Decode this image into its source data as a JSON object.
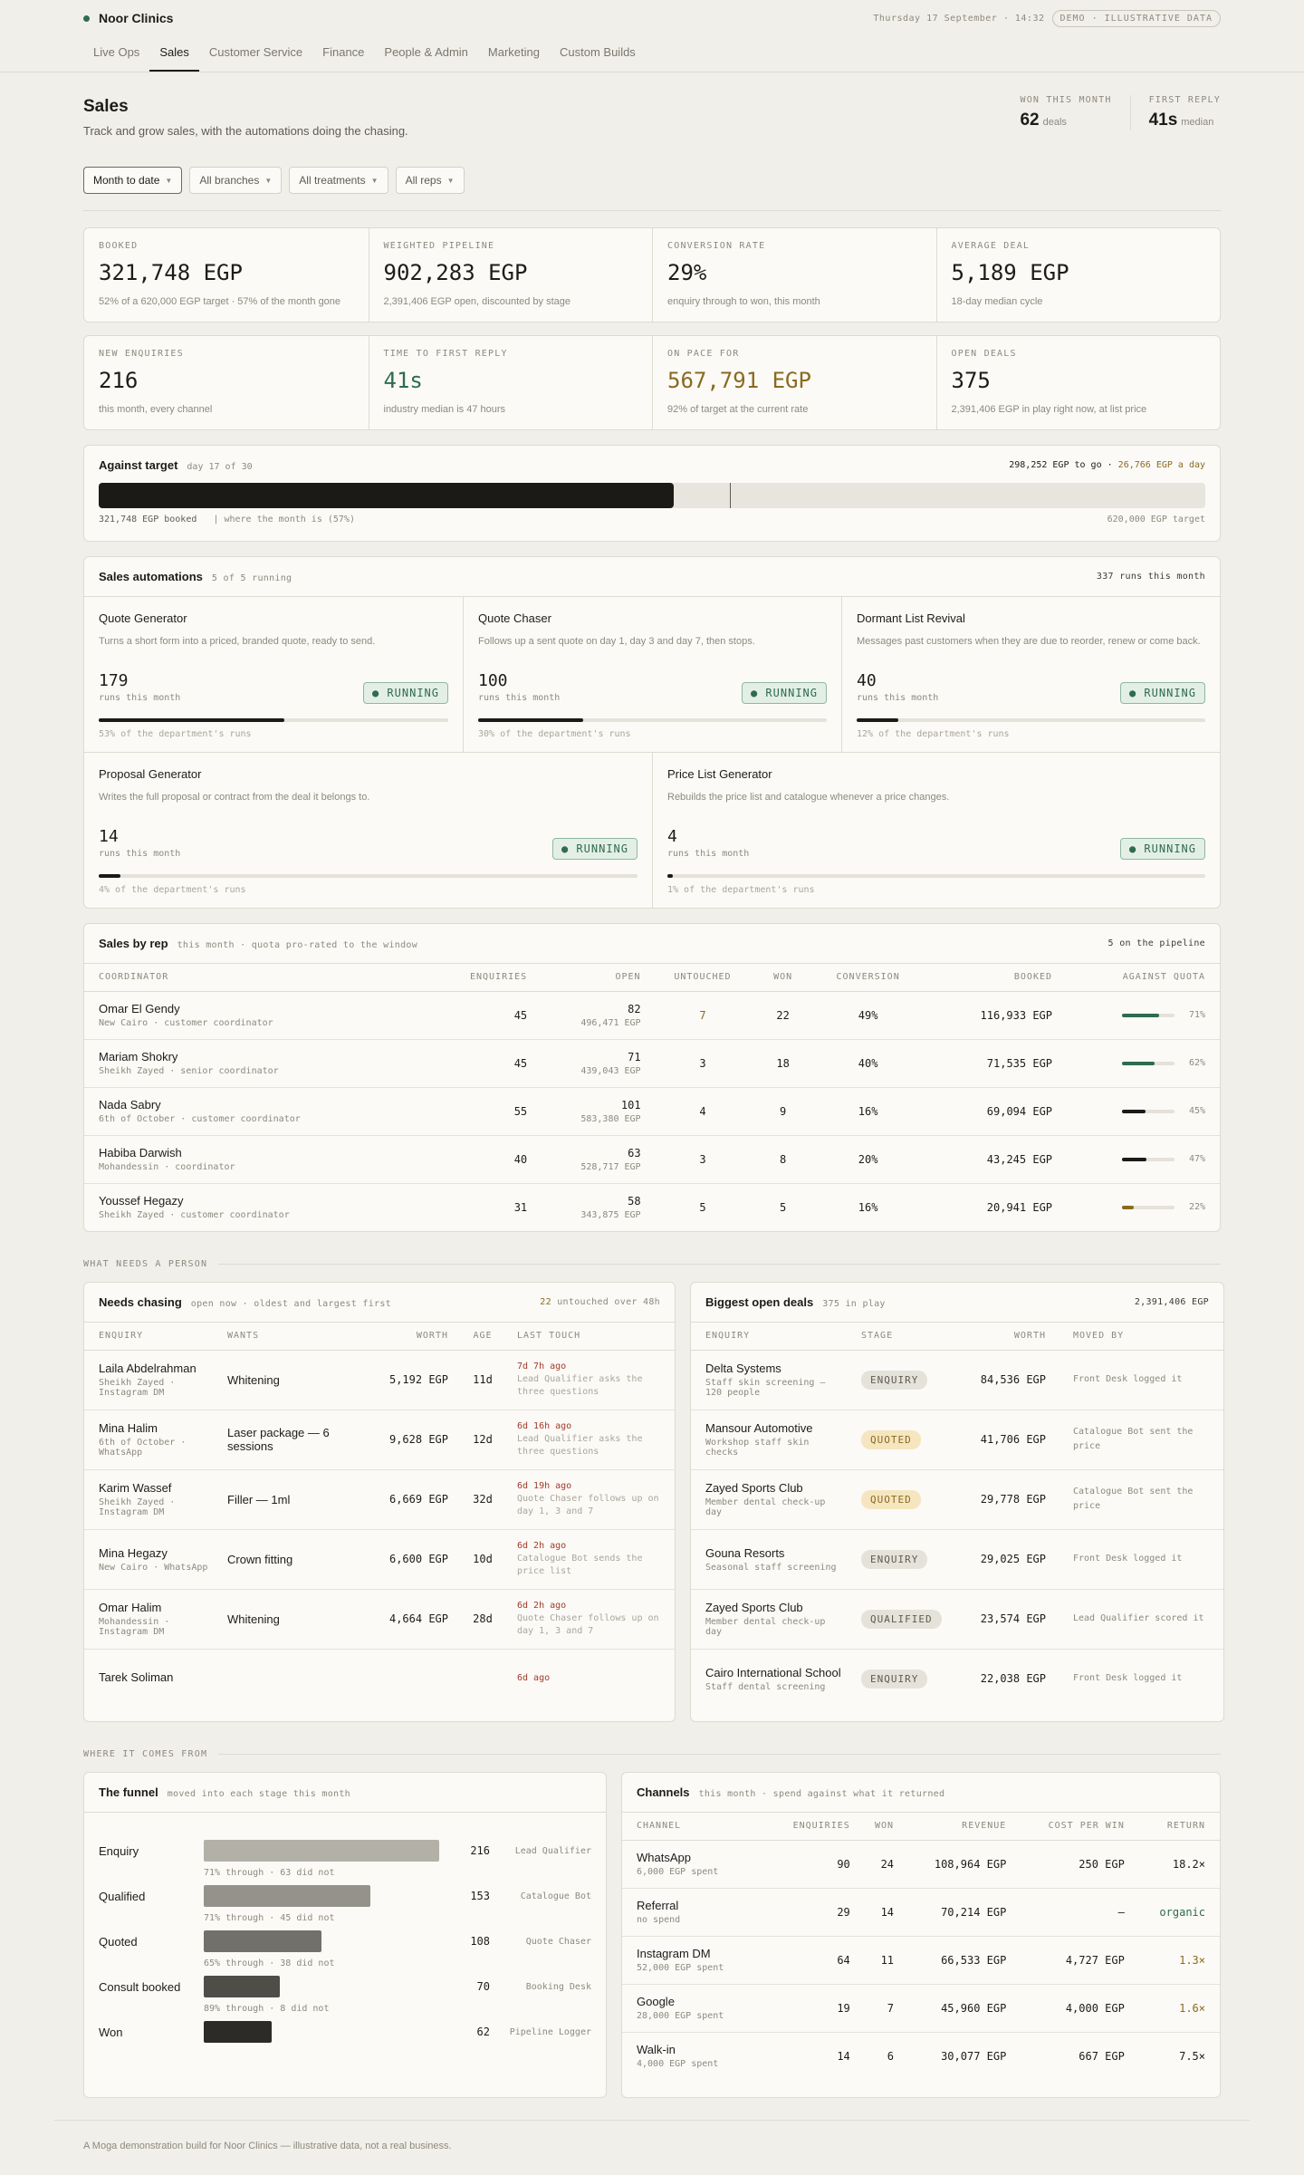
{
  "brand": "Noor Clinics",
  "datetime": "Thursday 17 September · 14:32",
  "demo_badge": "DEMO · ILLUSTRATIVE DATA",
  "tabs": [
    "Live Ops",
    "Sales",
    "Customer Service",
    "Finance",
    "People & Admin",
    "Marketing",
    "Custom Builds"
  ],
  "active_tab": "Sales",
  "page": {
    "title": "Sales",
    "subtitle": "Track and grow sales, with the automations doing the chasing."
  },
  "headstats": [
    {
      "label": "WON THIS MONTH",
      "value": "62",
      "unit": "deals"
    },
    {
      "label": "FIRST REPLY",
      "value": "41s",
      "unit": "median"
    }
  ],
  "filters": [
    "Month to date",
    "All branches",
    "All treatments",
    "All reps"
  ],
  "kpis": [
    {
      "label": "BOOKED",
      "value": "321,748 EGP",
      "note": "52% of a 620,000 EGP target · 57% of the month gone"
    },
    {
      "label": "WEIGHTED PIPELINE",
      "value": "902,283 EGP",
      "note": "2,391,406 EGP open, discounted by stage"
    },
    {
      "label": "CONVERSION RATE",
      "value": "29%",
      "note": "enquiry through to won, this month"
    },
    {
      "label": "AVERAGE DEAL",
      "value": "5,189 EGP",
      "note": "18-day median cycle"
    }
  ],
  "kpis2": [
    {
      "label": "NEW ENQUIRIES",
      "value": "216",
      "note": "this month, every channel"
    },
    {
      "label": "TIME TO FIRST REPLY",
      "value": "41s",
      "note": "industry median is 47 hours"
    },
    {
      "label": "ON PACE FOR",
      "value": "567,791 EGP",
      "note": "92% of target at the current rate"
    },
    {
      "label": "OPEN DEALS",
      "value": "375",
      "note": "2,391,406 EGP in play right now, at list price"
    }
  ],
  "target": {
    "title": "Against target",
    "day": "day 17 of 30",
    "to_go": "298,252 EGP to go · ",
    "per_day": "26,766 EGP a day",
    "booked_label": "321,748 EGP booked",
    "where_label": "| where the month is (57%)",
    "target_label": "620,000 EGP target",
    "fill_pct": 52,
    "month_pct": 57
  },
  "automations": {
    "title": "Sales automations",
    "sub": "5 of 5 running",
    "runs": "337 runs this month",
    "runs_label": "runs this month",
    "status": "● RUNNING",
    "items": [
      {
        "name": "Quote Generator",
        "desc": "Turns a short form into a priced, branded quote, ready to send.",
        "runs": "179",
        "pct_text": "53% of the department's runs",
        "pct": 53
      },
      {
        "name": "Quote Chaser",
        "desc": "Follows up a sent quote on day 1, day 3 and day 7, then stops.",
        "runs": "100",
        "pct_text": "30% of the department's runs",
        "pct": 30
      },
      {
        "name": "Dormant List Revival",
        "desc": "Messages past customers when they are due to reorder, renew or come back.",
        "runs": "40",
        "pct_text": "12% of the department's runs",
        "pct": 12
      },
      {
        "name": "Proposal Generator",
        "desc": "Writes the full proposal or contract from the deal it belongs to.",
        "runs": "14",
        "pct_text": "4% of the department's runs",
        "pct": 4
      },
      {
        "name": "Price List Generator",
        "desc": "Rebuilds the price list and catalogue whenever a price changes.",
        "runs": "4",
        "pct_text": "1% of the department's runs",
        "pct": 1
      }
    ]
  },
  "reps": {
    "title": "Sales by rep",
    "sub": "this month · quota pro-rated to the window",
    "right": "5 on the pipeline",
    "headers": [
      "COORDINATOR",
      "ENQUIRIES",
      "OPEN",
      "UNTOUCHED",
      "WON",
      "CONVERSION",
      "BOOKED",
      "AGAINST QUOTA"
    ],
    "rows": [
      {
        "name": "Omar El Gendy",
        "role": "New Cairo · customer coordinator",
        "enq": "45",
        "open": "82",
        "open_egp": "496,471 EGP",
        "untouched": "7",
        "won": "22",
        "conv": "49%",
        "booked": "116,933 EGP",
        "quota": "71%",
        "q": 71,
        "color": "#2f6b4f",
        "hl": true
      },
      {
        "name": "Mariam Shokry",
        "role": "Sheikh Zayed · senior coordinator",
        "enq": "45",
        "open": "71",
        "open_egp": "439,043 EGP",
        "untouched": "3",
        "won": "18",
        "conv": "40%",
        "booked": "71,535 EGP",
        "quota": "62%",
        "q": 62,
        "color": "#2f6b4f"
      },
      {
        "name": "Nada Sabry",
        "role": "6th of October · customer coordinator",
        "enq": "55",
        "open": "101",
        "open_egp": "583,380 EGP",
        "untouched": "4",
        "won": "9",
        "conv": "16%",
        "booked": "69,094 EGP",
        "quota": "45%",
        "q": 45,
        "color": "#1c1a16"
      },
      {
        "name": "Habiba Darwish",
        "role": "Mohandessin · coordinator",
        "enq": "40",
        "open": "63",
        "open_egp": "528,717 EGP",
        "untouched": "3",
        "won": "8",
        "conv": "20%",
        "booked": "43,245 EGP",
        "quota": "47%",
        "q": 47,
        "color": "#1c1a16"
      },
      {
        "name": "Youssef Hegazy",
        "role": "Sheikh Zayed · customer coordinator",
        "enq": "31",
        "open": "58",
        "open_egp": "343,875 EGP",
        "untouched": "5",
        "won": "5",
        "conv": "16%",
        "booked": "20,941 EGP",
        "quota": "22%",
        "q": 22,
        "color": "#8a6a20"
      }
    ]
  },
  "section1": "WHAT NEEDS A PERSON",
  "chasing": {
    "title": "Needs chasing",
    "sub": "open now · oldest and largest first",
    "right_num": "22",
    "right": " untouched over 48h",
    "headers": [
      "ENQUIRY",
      "WANTS",
      "WORTH",
      "AGE",
      "LAST TOUCH"
    ],
    "rows": [
      {
        "name": "Laila Abdelrahman",
        "meta": "Sheikh Zayed · Instagram DM",
        "wants": "Whitening",
        "worth": "5,192 EGP",
        "age": "11d",
        "t1": "7d 7h ago",
        "t2": "Lead Qualifier asks the three questions"
      },
      {
        "name": "Mina Halim",
        "meta": "6th of October · WhatsApp",
        "wants": "Laser package — 6 sessions",
        "worth": "9,628 EGP",
        "age": "12d",
        "t1": "6d 16h ago",
        "t2": "Lead Qualifier asks the three questions"
      },
      {
        "name": "Karim Wassef",
        "meta": "Sheikh Zayed · Instagram DM",
        "wants": "Filler — 1ml",
        "worth": "6,669 EGP",
        "age": "32d",
        "t1": "6d 19h ago",
        "t2": "Quote Chaser follows up on day 1, 3 and 7"
      },
      {
        "name": "Mina Hegazy",
        "meta": "New Cairo · WhatsApp",
        "wants": "Crown fitting",
        "worth": "6,600 EGP",
        "age": "10d",
        "t1": "6d 2h ago",
        "t2": "Catalogue Bot sends the price list"
      },
      {
        "name": "Omar Halim",
        "meta": "Mohandessin · Instagram DM",
        "wants": "Whitening",
        "worth": "4,664 EGP",
        "age": "28d",
        "t1": "6d 2h ago",
        "t2": "Quote Chaser follows up on day 1, 3 and 7"
      },
      {
        "name": "Tarek Soliman",
        "meta": "",
        "wants": "",
        "worth": "",
        "age": "",
        "t1": "6d ago",
        "t2": ""
      }
    ]
  },
  "deals": {
    "title": "Biggest open deals",
    "sub": "375 in play",
    "right": "2,391,406 EGP",
    "headers": [
      "ENQUIRY",
      "STAGE",
      "WORTH",
      "MOVED BY"
    ],
    "rows": [
      {
        "name": "Delta Systems",
        "meta": "Staff skin screening — 120 people",
        "stage": "ENQUIRY",
        "cls": "st-enq",
        "worth": "84,536 EGP",
        "moved": "Front Desk logged it"
      },
      {
        "name": "Mansour Automotive",
        "meta": "Workshop staff skin checks",
        "stage": "QUOTED",
        "cls": "st-quo",
        "worth": "41,706 EGP",
        "moved": "Catalogue Bot sent the price"
      },
      {
        "name": "Zayed Sports Club",
        "meta": "Member dental check-up day",
        "stage": "QUOTED",
        "cls": "st-quo",
        "worth": "29,778 EGP",
        "moved": "Catalogue Bot sent the price"
      },
      {
        "name": "Gouna Resorts",
        "meta": "Seasonal staff screening",
        "stage": "ENQUIRY",
        "cls": "st-enq",
        "worth": "29,025 EGP",
        "moved": "Front Desk logged it"
      },
      {
        "name": "Zayed Sports Club",
        "meta": "Member dental check-up day",
        "stage": "QUALIFIED",
        "cls": "st-qual",
        "worth": "23,574 EGP",
        "moved": "Lead Qualifier scored it"
      },
      {
        "name": "Cairo International School",
        "meta": "Staff dental screening",
        "stage": "ENQUIRY",
        "cls": "st-enq",
        "worth": "22,038 EGP",
        "moved": "Front Desk logged it"
      }
    ]
  },
  "section2": "WHERE IT COMES FROM",
  "funnel": {
    "title": "The funnel",
    "sub": "moved into each stage this month",
    "stages": [
      {
        "label": "Enquiry",
        "value": 216,
        "owner": "Lead Qualifier",
        "color": "#b3b0a8",
        "through": "71% through · 63 did not"
      },
      {
        "label": "Qualified",
        "value": 153,
        "owner": "Catalogue Bot",
        "color": "#95928b",
        "through": "71% through · 45 did not"
      },
      {
        "label": "Quoted",
        "value": 108,
        "owner": "Quote Chaser",
        "color": "#72706a",
        "through": "65% through · 38 did not"
      },
      {
        "label": "Consult booked",
        "value": 70,
        "owner": "Booking Desk",
        "color": "#4f4d48",
        "through": "89% through · 8 did not"
      },
      {
        "label": "Won",
        "value": 62,
        "owner": "Pipeline Logger",
        "color": "#2d2b28",
        "through": ""
      }
    ]
  },
  "channels": {
    "title": "Channels",
    "sub": "this month · spend against what it returned",
    "headers": [
      "CHANNEL",
      "ENQUIRIES",
      "WON",
      "REVENUE",
      "COST PER WIN",
      "RETURN"
    ],
    "rows": [
      {
        "name": "WhatsApp",
        "spent": "6,000 EGP spent",
        "enq": "90",
        "won": "24",
        "rev": "108,964 EGP",
        "cpw": "250 EGP",
        "ret": "18.2×",
        "rc": "#1e1c18"
      },
      {
        "name": "Referral",
        "spent": "no spend",
        "enq": "29",
        "won": "14",
        "rev": "70,214 EGP",
        "cpw": "—",
        "ret": "organic",
        "rc": "#2f6b4f"
      },
      {
        "name": "Instagram DM",
        "spent": "52,000 EGP spent",
        "enq": "64",
        "won": "11",
        "rev": "66,533 EGP",
        "cpw": "4,727 EGP",
        "ret": "1.3×",
        "rc": "#8a6a20"
      },
      {
        "name": "Google",
        "spent": "28,000 EGP spent",
        "enq": "19",
        "won": "7",
        "rev": "45,960 EGP",
        "cpw": "4,000 EGP",
        "ret": "1.6×",
        "rc": "#8a6a20"
      },
      {
        "name": "Walk-in",
        "spent": "4,000 EGP spent",
        "enq": "14",
        "won": "6",
        "rev": "30,077 EGP",
        "cpw": "667 EGP",
        "ret": "7.5×",
        "rc": "#1e1c18"
      }
    ]
  },
  "footer": "A Moga demonstration build for Noor Clinics — illustrative data, not a real business."
}
